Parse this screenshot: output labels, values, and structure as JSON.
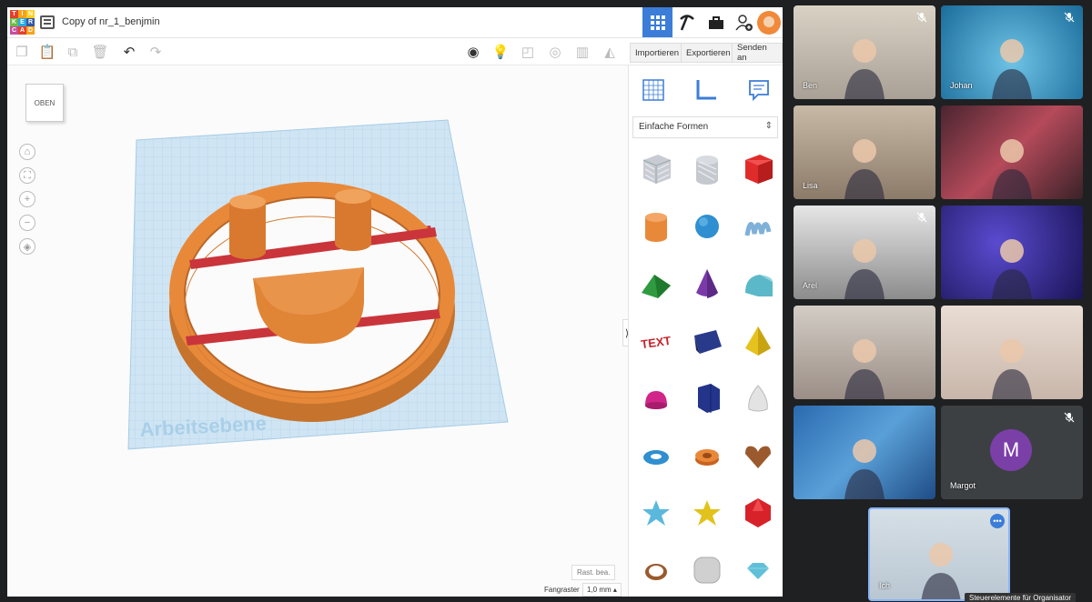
{
  "tinkercad": {
    "logo_letters": [
      "TIN",
      "KER",
      "CAD"
    ],
    "logo_colors": [
      "#e3412b",
      "#f7a21b",
      "#ffcf1f",
      "#6fbb44",
      "#27a9e1",
      "#3457a6",
      "#c64e9c",
      "#e3412b",
      "#f7a21b"
    ],
    "document_title": "Copy of nr_1_benjmin",
    "header_icons": [
      "grid-view-icon",
      "pickaxe-icon",
      "briefcase-icon",
      "add-user-icon"
    ],
    "toolbar": {
      "import_label": "Importieren",
      "export_label": "Exportieren",
      "send_label": "Senden an"
    },
    "workplane": {
      "viewcube_label": "OBEN",
      "plane_label": "Arbeitsebene",
      "edit_grid_label": "Rast. bea.",
      "snap_grid_label": "Fangraster",
      "snap_grid_value": "1,0 mm ▴"
    },
    "shapes_panel": {
      "category": "Einfache Formen",
      "shapes": [
        "box-striped",
        "cylinder-striped",
        "box",
        "cylinder",
        "sphere",
        "scribble",
        "roof",
        "cone",
        "round-roof",
        "text",
        "wedge",
        "pyramid",
        "half-sphere",
        "polygon",
        "paraboloid",
        "torus",
        "tube",
        "heart",
        "star",
        "star-gold",
        "icosahedron",
        "ring",
        "cube-rounded",
        "diamond"
      ]
    },
    "accent": "#3b7dd8",
    "object_color": "#e8893a"
  },
  "meeting": {
    "participants": [
      {
        "name": "Ben",
        "muted": true
      },
      {
        "name": "Johan",
        "muted": true
      },
      {
        "name": "Lisa",
        "muted": false
      },
      {
        "name": "",
        "muted": false
      },
      {
        "name": "Arel",
        "muted": true
      },
      {
        "name": "",
        "muted": false
      },
      {
        "name": "",
        "muted": false
      },
      {
        "name": "",
        "muted": false
      },
      {
        "name": "",
        "muted": false
      },
      {
        "name": "Margot",
        "muted": true,
        "initial": "M"
      },
      {
        "name": "Ich",
        "muted": false
      }
    ],
    "organizer_tooltip": "Steuerelemente für Organisator",
    "self_highlight": "#8ab4f8",
    "initial_avatar_color": "#7b3fa8"
  }
}
